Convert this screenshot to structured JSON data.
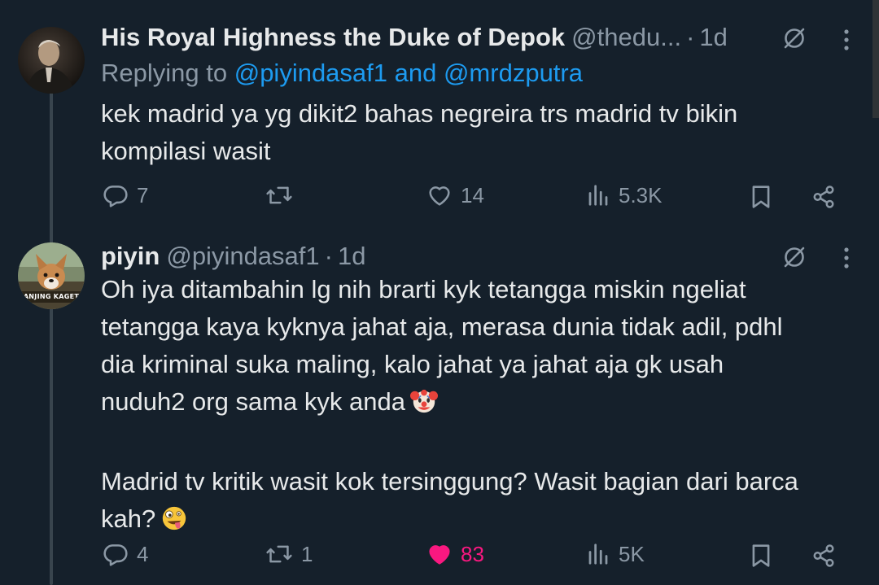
{
  "tweets": [
    {
      "display_name": "His Royal Highness the Duke of Depok",
      "handle": "@thedu...",
      "time": "1d",
      "replying_prefix": "Replying to",
      "replying_users": "@piyindasaf1 and @mrdzputra",
      "text": "kek madrid ya yg dikit2 bahas negreira trs madrid tv bikin\nkompilasi wasit",
      "actions": {
        "replies": "7",
        "reposts": "",
        "likes": "14",
        "views": "5.3K"
      },
      "liked": false
    },
    {
      "display_name": "piyin",
      "handle": "@piyindasaf1",
      "time": "1d",
      "avatar_caption": "ANJING KAGET",
      "text_part1": "Oh iya ditambahin lg nih brarti kyk tetangga miskin ngeliat\ntetangga kaya kyknya jahat aja, merasa dunia tidak adil, pdhl\ndia kriminal suka maling, kalo jahat ya jahat aja gk usah\nnuduh2 org sama kyk anda",
      "emoji1": "clown-face",
      "text_part2": "Madrid tv kritik wasit kok tersinggung? Wasit bagian dari barca\nkah?",
      "emoji2": "zany-face",
      "actions": {
        "replies": "4",
        "reposts": "1",
        "likes": "83",
        "views": "5K"
      },
      "liked": true
    }
  ],
  "colors": {
    "background": "#15202b",
    "text": "#e7e9ea",
    "muted": "#8b98a5",
    "link": "#1d9bf0",
    "like": "#f91880",
    "thread_line": "#38444d"
  }
}
